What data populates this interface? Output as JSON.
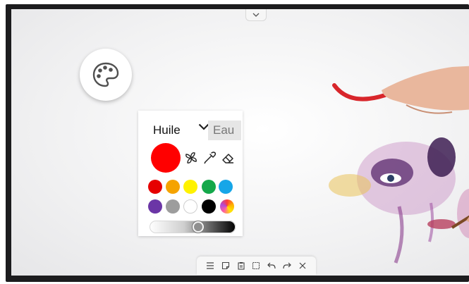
{
  "brush_panel": {
    "tabs": [
      {
        "label": "Huile",
        "active": true
      },
      {
        "label": "Eau",
        "active": false
      }
    ],
    "selected_color": "#ff0000",
    "tools": [
      "fan-brush-icon",
      "eyedropper-icon",
      "eraser-icon"
    ],
    "swatches_row1": [
      "#e60000",
      "#f5a300",
      "#fff200",
      "#14a84a",
      "#16a6e8"
    ],
    "swatches_row2": [
      "#6b36a6",
      "#9d9d9d",
      "#ffffff",
      "#000000",
      "rainbow"
    ],
    "opacity_slider_fraction": 0.58
  },
  "toolbar": {
    "icons": [
      "menu-icon",
      "sticky-note-icon",
      "paste-icon",
      "select-icon",
      "undo-icon",
      "redo-icon",
      "close-icon"
    ]
  },
  "palette_button": {
    "icon": "palette-icon"
  },
  "top_handle": {
    "icon": "chevron-down-icon"
  }
}
